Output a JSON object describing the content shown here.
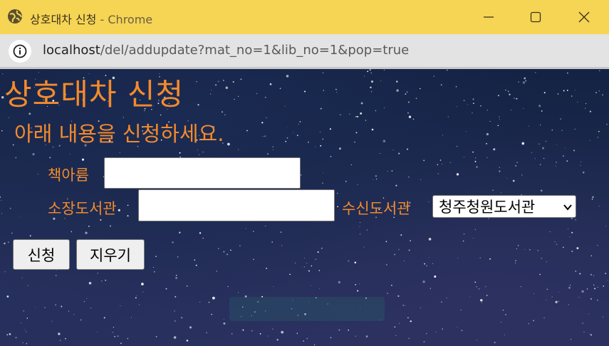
{
  "window": {
    "title": "상호대차 신청",
    "title_separator": "-",
    "app_name": "Chrome",
    "titlebar_color": "#f6d454"
  },
  "addressbar": {
    "info_icon": "info-icon",
    "host": "localhost",
    "path": "/del/addupdate?mat_no=1&lib_no=1&pop=true"
  },
  "page": {
    "heading": "상호대차 신청",
    "subheading": "아래 내용을 신청하세요.",
    "accent_color": "#f38b2c",
    "form": {
      "book_name_label": "책아름",
      "book_name_value": "",
      "holding_library_label": "소장도서관",
      "holding_library_value": "",
      "receiving_library_label": "수신도서관",
      "receiving_library_selected": "청주청원도서관"
    },
    "buttons": {
      "submit_label": "신청",
      "clear_label": "지우기"
    }
  }
}
